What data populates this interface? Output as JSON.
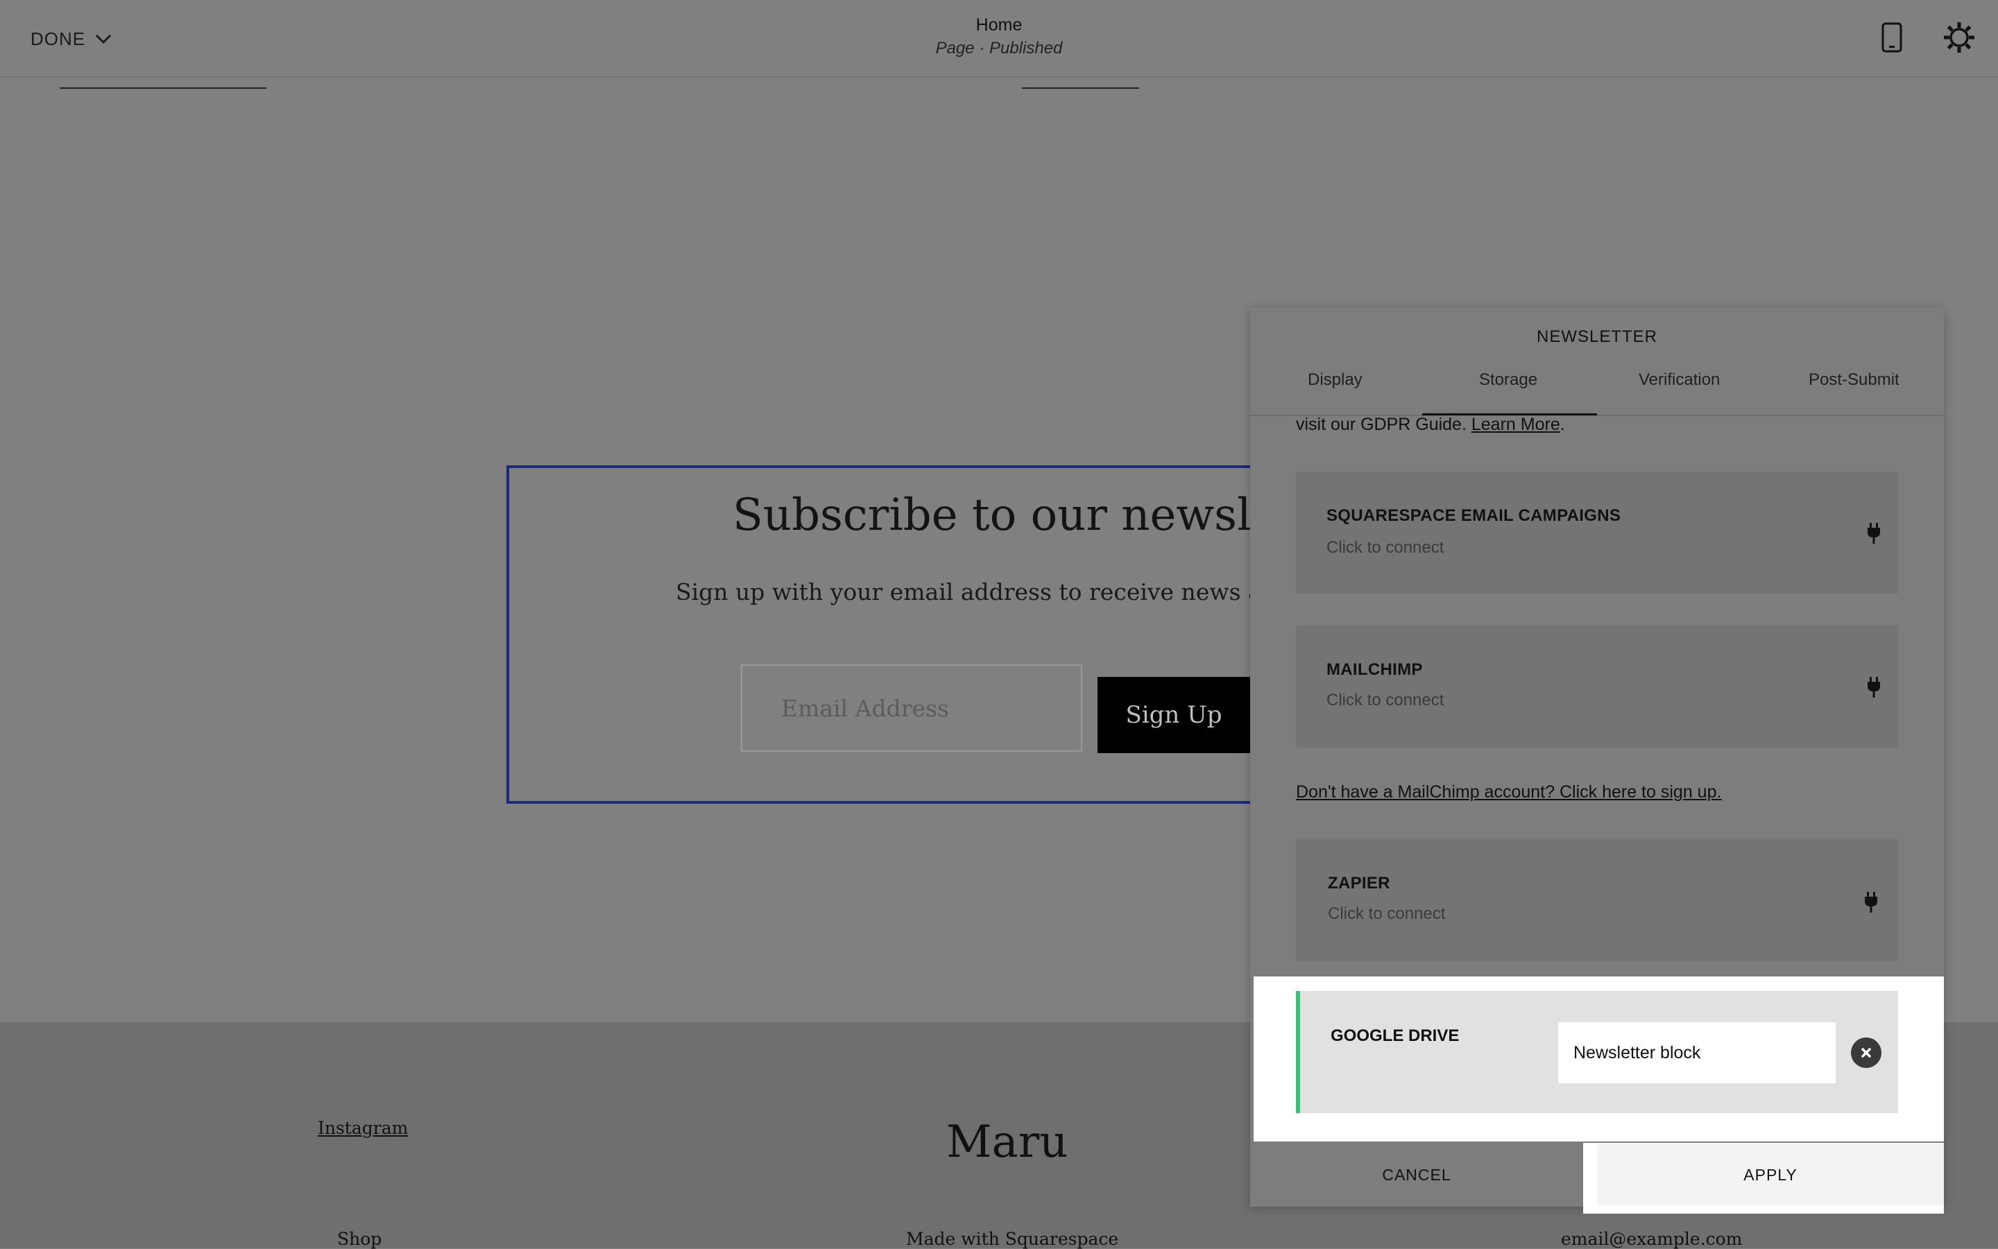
{
  "topbar": {
    "done_label": "DONE",
    "page_title": "Home",
    "page_status": "Page · Published"
  },
  "newsletter_block": {
    "title": "Subscribe to our newsletter",
    "description": "Sign up with your email address to receive news and up",
    "email_placeholder": "Email Address",
    "button_label": "Sign Up"
  },
  "footer": {
    "instagram": "Instagram",
    "brand": "Maru",
    "shop": "Shop",
    "made_with": "Made with Squarespace",
    "email": "email@example.com"
  },
  "panel": {
    "title": "NEWSLETTER",
    "tabs": [
      {
        "label": "Display"
      },
      {
        "label": "Storage"
      },
      {
        "label": "Verification"
      },
      {
        "label": "Post-Submit"
      }
    ],
    "active_tab": "Storage",
    "gdpr_text": "visit our GDPR Guide.",
    "gdpr_link": "Learn More",
    "gdpr_end": ".",
    "storage_options": [
      {
        "name": "SQUARESPACE EMAIL CAMPAIGNS",
        "status": "Click to connect",
        "icon": "plug-icon"
      },
      {
        "name": "MAILCHIMP",
        "status": "Click to connect",
        "icon": "plug-icon"
      },
      {
        "name": "ZAPIER",
        "status": "Click to connect",
        "icon": "plug-icon"
      }
    ],
    "mailchimp_signup": "Don't have a MailChimp account? Click here to sign up.",
    "google_drive": {
      "name": "GOOGLE DRIVE",
      "value": "Newsletter block",
      "accent_color": "#3bbf75"
    },
    "cancel_label": "CANCEL",
    "apply_label": "APPLY"
  },
  "colors": {
    "overlay": "#808080",
    "block_border": "#1e2a78",
    "connected_accent": "#3bbf75"
  }
}
